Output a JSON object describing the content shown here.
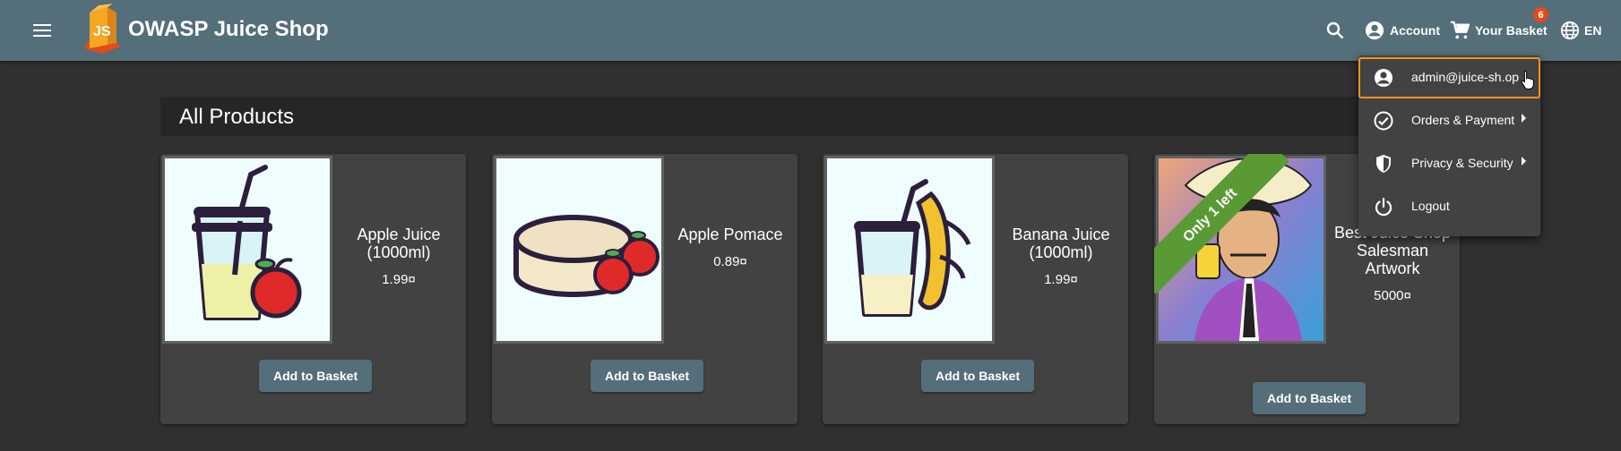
{
  "toolbar": {
    "title": "OWASP Juice Shop",
    "account_label": "Account",
    "basket_label": "Your Basket",
    "basket_count": "6",
    "language": "EN",
    "logo_text": "JS"
  },
  "main": {
    "section_title": "All Products",
    "products": [
      {
        "name": "Apple Juice (1000ml)",
        "price": "1.99¤",
        "button": "Add to Basket"
      },
      {
        "name": "Apple Pomace",
        "price": "0.89¤",
        "button": "Add to Basket"
      },
      {
        "name": "Banana Juice (1000ml)",
        "price": "1.99¤",
        "button": "Add to Basket"
      },
      {
        "name": "Best Juice Shop Salesman Artwork",
        "price": "5000¤",
        "button": "Add to Basket",
        "ribbon": "Only 1 left"
      }
    ]
  },
  "account_menu": {
    "items": [
      {
        "label": "admin@juice-sh.op",
        "icon": "account-circle-icon"
      },
      {
        "label": "Orders & Payment",
        "icon": "check-circle-icon"
      },
      {
        "label": "Privacy & Security",
        "icon": "shield-icon"
      },
      {
        "label": "Logout",
        "icon": "power-icon"
      }
    ]
  },
  "colors": {
    "toolbar": "#546e7a",
    "background": "#303030",
    "card": "#424242",
    "badge": "#e64a19",
    "ribbon": "#5a9a35",
    "focus": "#f7931e"
  }
}
